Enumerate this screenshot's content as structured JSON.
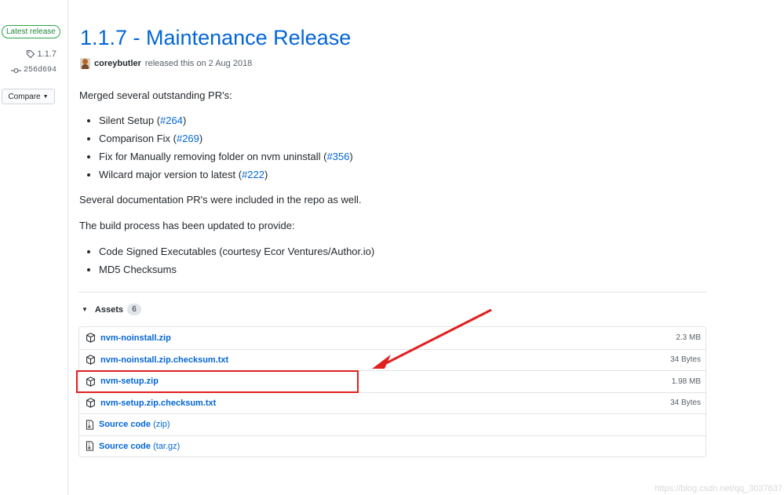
{
  "sidebar": {
    "latest_badge": "Latest release",
    "tag": "1.1.7",
    "commit": "256d694",
    "compare_label": "Compare"
  },
  "release": {
    "title": "1.1.7 - Maintenance Release",
    "author": "coreybutler",
    "released_text": "released this on 2 Aug 2018",
    "intro": "Merged several outstanding PR's:",
    "prs": [
      {
        "text": "Silent Setup (",
        "link": "#264",
        "close": ")"
      },
      {
        "text": "Comparison Fix (",
        "link": "#269",
        "close": ")"
      },
      {
        "text": "Fix for Manually removing folder on nvm uninstall (",
        "link": "#356",
        "close": ")"
      },
      {
        "text": "Wilcard major version to latest (",
        "link": "#222",
        "close": ")"
      }
    ],
    "docs_note": "Several documentation PR's were included in the repo as well.",
    "build_note": "The build process has been updated to provide:",
    "build_items": [
      "Code Signed Executables (courtesy Ecor Ventures/Author.io)",
      "MD5 Checksums"
    ]
  },
  "assets": {
    "label": "Assets",
    "count": "6",
    "files": [
      {
        "name": "nvm-noinstall.zip",
        "size": "2.3 MB",
        "icon": "package-icon"
      },
      {
        "name": "nvm-noinstall.zip.checksum.txt",
        "size": "34 Bytes",
        "icon": "package-icon"
      },
      {
        "name": "nvm-setup.zip",
        "size": "1.98 MB",
        "icon": "package-icon"
      },
      {
        "name": "nvm-setup.zip.checksum.txt",
        "size": "34 Bytes",
        "icon": "package-icon"
      },
      {
        "name": "Source code",
        "suffix": "(zip)",
        "size": "",
        "icon": "file-zip-icon"
      },
      {
        "name": "Source code",
        "suffix": "(tar.gz)",
        "size": "",
        "icon": "file-zip-icon"
      }
    ]
  },
  "annotation": {
    "color": "#e02020"
  },
  "colors": {
    "link": "#0366d6",
    "badge_green": "#28a745",
    "text": "#24292e",
    "muted": "#586069"
  },
  "watermark": "https://blog.csdn.net/qq_3037637"
}
